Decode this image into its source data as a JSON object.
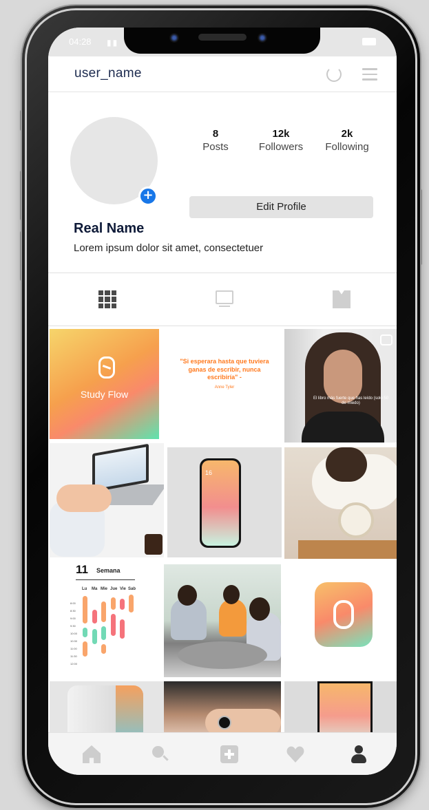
{
  "status_bar": {
    "time": "04:28"
  },
  "header": {
    "username": "user_name"
  },
  "profile": {
    "stats": [
      {
        "value": "8",
        "label": "Posts"
      },
      {
        "value": "12k",
        "label": "Followers"
      },
      {
        "value": "2k",
        "label": "Following"
      }
    ],
    "edit_button": "Edit Profile",
    "real_name": "Real Name",
    "bio": "Lorem ipsum dolor sit amet, consectetuer"
  },
  "tabs": [
    {
      "icon": "grid-icon",
      "active": true
    },
    {
      "icon": "feed-icon",
      "active": false
    },
    {
      "icon": "tagged-icon",
      "active": false
    }
  ],
  "posts": {
    "study_flow": "Study Flow",
    "quote": "\"Si esperara hasta que tuviera ganas de escribir, nunca escribiría\" -",
    "quote_author": "Anne Tyler",
    "video_caption": "El libro más fuerte que has leído (solo 50 de miedo)",
    "phone_date": "16",
    "schedule_day": "11",
    "schedule_title": "Semana",
    "schedule_weekdays": [
      "Lu",
      "Ma",
      "Mie",
      "Jue",
      "Vie",
      "Sab"
    ],
    "schedule_hours": [
      "8:00",
      "8:30",
      "9:00",
      "9:30",
      "10:00",
      "10:30",
      "11:00",
      "11:30",
      "12:00"
    ]
  },
  "bottom_nav": [
    "home-icon",
    "search-icon",
    "add-icon",
    "heart-icon",
    "profile-icon"
  ],
  "colors": {
    "accent_blue": "#1877e8",
    "brand_orange": "#f6a04d",
    "brand_mint": "#5de3ae"
  }
}
